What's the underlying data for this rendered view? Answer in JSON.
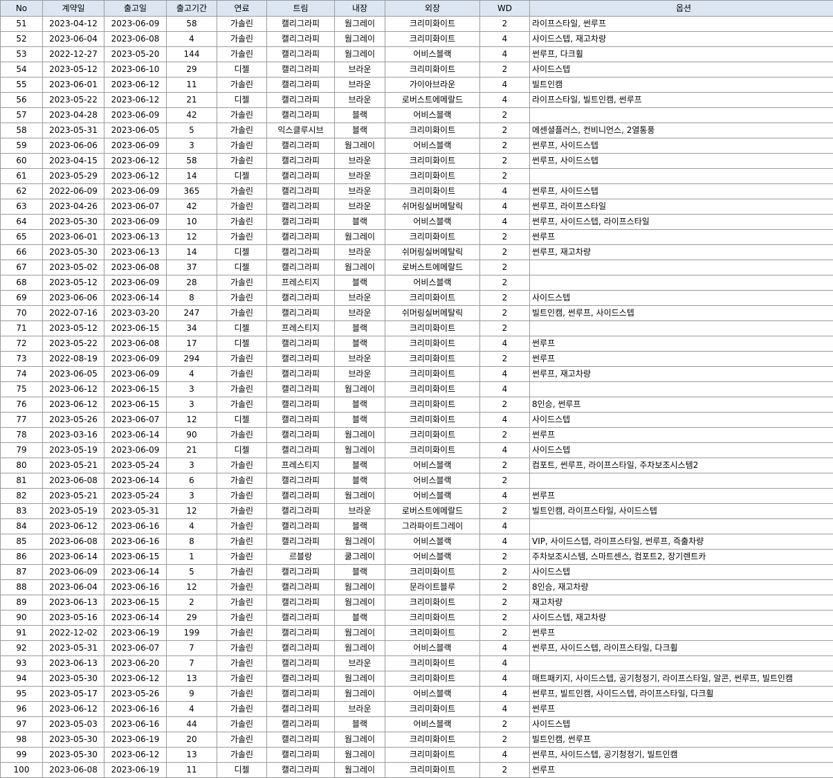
{
  "headers": [
    "No",
    "계약일",
    "출고일",
    "출고기간",
    "연료",
    "트림",
    "내장",
    "외장",
    "WD",
    "옵션"
  ],
  "rows": [
    [
      "51",
      "2023-04-12",
      "2023-06-09",
      "58",
      "가솔린",
      "캘리그라피",
      "웜그레이",
      "크리미화이트",
      "2",
      "라이프스타일, 썬루프"
    ],
    [
      "52",
      "2023-06-04",
      "2023-06-08",
      "4",
      "가솔린",
      "캘리그라피",
      "웜그레이",
      "크리미화이트",
      "4",
      "사이드스텝, 재고차량"
    ],
    [
      "53",
      "2022-12-27",
      "2023-05-20",
      "144",
      "가솔린",
      "캘리그라피",
      "웜그레이",
      "어비스블랙",
      "4",
      "썬루프, 다크휠"
    ],
    [
      "54",
      "2023-05-12",
      "2023-06-10",
      "29",
      "디젤",
      "캘리그라피",
      "브라운",
      "크리미화이트",
      "2",
      "사이드스텝"
    ],
    [
      "55",
      "2023-06-01",
      "2023-06-12",
      "11",
      "가솔린",
      "캘리그라피",
      "브라운",
      "가이아브라운",
      "4",
      "빌트인캠"
    ],
    [
      "56",
      "2023-05-22",
      "2023-06-12",
      "21",
      "디젤",
      "캘리그라피",
      "브라운",
      "로버스트에메랄드",
      "4",
      "라이프스타일, 빌트인캠, 썬루프"
    ],
    [
      "57",
      "2023-04-28",
      "2023-06-09",
      "42",
      "가솔린",
      "캘리그라피",
      "블랙",
      "어비스블랙",
      "2",
      ""
    ],
    [
      "58",
      "2023-05-31",
      "2023-06-05",
      "5",
      "가솔린",
      "익스클루시브",
      "블랙",
      "크리미화이트",
      "2",
      "에센셜플러스, 컨비니언스, 2열통풍"
    ],
    [
      "59",
      "2023-06-06",
      "2023-06-09",
      "3",
      "가솔린",
      "캘리그라피",
      "웜그레이",
      "어비스블랙",
      "2",
      "썬루프, 사이드스텝"
    ],
    [
      "60",
      "2023-04-15",
      "2023-06-12",
      "58",
      "가솔린",
      "캘리그라피",
      "브라운",
      "크리미화이트",
      "2",
      "썬루프, 사이드스텝"
    ],
    [
      "61",
      "2023-05-29",
      "2023-06-12",
      "14",
      "디젤",
      "캘리그라피",
      "브라운",
      "크리미화이트",
      "2",
      ""
    ],
    [
      "62",
      "2022-06-09",
      "2023-06-09",
      "365",
      "가솔린",
      "캘리그라피",
      "브라운",
      "크리미화이트",
      "4",
      "썬루프, 사이드스텝"
    ],
    [
      "63",
      "2023-04-26",
      "2023-06-07",
      "42",
      "가솔린",
      "캘리그라피",
      "브라운",
      "쉬머링실버메탈릭",
      "4",
      "썬루프, 라이프스타일"
    ],
    [
      "64",
      "2023-05-30",
      "2023-06-09",
      "10",
      "가솔린",
      "캘리그라피",
      "블랙",
      "어비스블랙",
      "4",
      "썬루프, 사이드스텝, 라이프스타일"
    ],
    [
      "65",
      "2023-06-01",
      "2023-06-13",
      "12",
      "가솔린",
      "캘리그라피",
      "웜그레이",
      "크리미화이트",
      "2",
      "썬루프"
    ],
    [
      "66",
      "2023-05-30",
      "2023-06-13",
      "14",
      "디젤",
      "캘리그라피",
      "브라운",
      "쉬머링실버메탈릭",
      "2",
      "썬루프, 재고차량"
    ],
    [
      "67",
      "2023-05-02",
      "2023-06-08",
      "37",
      "디젤",
      "캘리그라피",
      "웜그레이",
      "로버스트에메랄드",
      "2",
      ""
    ],
    [
      "68",
      "2023-05-12",
      "2023-06-09",
      "28",
      "가솔린",
      "프레스티지",
      "블랙",
      "어비스블랙",
      "2",
      ""
    ],
    [
      "69",
      "2023-06-06",
      "2023-06-14",
      "8",
      "가솔린",
      "캘리그라피",
      "브라운",
      "크리미화이트",
      "2",
      "사이드스텝"
    ],
    [
      "70",
      "2022-07-16",
      "2023-03-20",
      "247",
      "가솔린",
      "캘리그라피",
      "브라운",
      "쉬머링실버메탈릭",
      "2",
      "빌트인캠, 썬루프, 사이드스텝"
    ],
    [
      "71",
      "2023-05-12",
      "2023-06-15",
      "34",
      "디젤",
      "프레스티지",
      "블랙",
      "크리미화이트",
      "2",
      ""
    ],
    [
      "72",
      "2023-05-22",
      "2023-06-08",
      "17",
      "디젤",
      "캘리그라피",
      "블랙",
      "크리미화이트",
      "4",
      "썬루프"
    ],
    [
      "73",
      "2022-08-19",
      "2023-06-09",
      "294",
      "가솔린",
      "캘리그라피",
      "브라운",
      "크리미화이트",
      "2",
      "썬루프"
    ],
    [
      "74",
      "2023-06-05",
      "2023-06-09",
      "4",
      "가솔린",
      "캘리그라피",
      "브라운",
      "크리미화이트",
      "4",
      "썬루프, 재고차량"
    ],
    [
      "75",
      "2023-06-12",
      "2023-06-15",
      "3",
      "가솔린",
      "캘리그라피",
      "웜그레이",
      "크리미화이트",
      "4",
      ""
    ],
    [
      "76",
      "2023-06-12",
      "2023-06-15",
      "3",
      "가솔린",
      "캘리그라피",
      "블랙",
      "크리미화이트",
      "2",
      "8인승, 썬루프"
    ],
    [
      "77",
      "2023-05-26",
      "2023-06-07",
      "12",
      "디젤",
      "캘리그라피",
      "블랙",
      "크리미화이트",
      "4",
      "사이드스텝"
    ],
    [
      "78",
      "2023-03-16",
      "2023-06-14",
      "90",
      "가솔린",
      "캘리그라피",
      "웜그레이",
      "크리미화이트",
      "2",
      "썬루프"
    ],
    [
      "79",
      "2023-05-19",
      "2023-06-09",
      "21",
      "디젤",
      "캘리그라피",
      "웜그레이",
      "크리미화이트",
      "4",
      "사이드스텝"
    ],
    [
      "80",
      "2023-05-21",
      "2023-05-24",
      "3",
      "가솔린",
      "프레스티지",
      "블랙",
      "어비스블랙",
      "2",
      "컴포트, 썬루프, 라이프스타일, 주차보조시스템2"
    ],
    [
      "81",
      "2023-06-08",
      "2023-06-14",
      "6",
      "가솔린",
      "캘리그라피",
      "블랙",
      "어비스블랙",
      "2",
      ""
    ],
    [
      "82",
      "2023-05-21",
      "2023-05-24",
      "3",
      "가솔린",
      "캘리그라피",
      "웜그레이",
      "어비스블랙",
      "4",
      "썬루프"
    ],
    [
      "83",
      "2023-05-19",
      "2023-05-31",
      "12",
      "가솔린",
      "캘리그라피",
      "브라운",
      "로버스트에메랄드",
      "2",
      "빌트인캠, 라이프스타일, 사이드스텝"
    ],
    [
      "84",
      "2023-06-12",
      "2023-06-16",
      "4",
      "가솔린",
      "캘리그라피",
      "블랙",
      "그라파이트그레이",
      "4",
      ""
    ],
    [
      "85",
      "2023-06-08",
      "2023-06-16",
      "8",
      "가솔린",
      "캘리그라피",
      "웜그레이",
      "어비스블랙",
      "4",
      "VIP, 사이드스텝, 라이프스타일, 썬루프, 즉출차량"
    ],
    [
      "86",
      "2023-06-14",
      "2023-06-15",
      "1",
      "가솔린",
      "르블랑",
      "쿨그레이",
      "어비스블랙",
      "2",
      "주차보조시스템, 스마트센스, 컴포트2, 장기렌트카"
    ],
    [
      "87",
      "2023-06-09",
      "2023-06-14",
      "5",
      "가솔린",
      "캘리그라피",
      "블랙",
      "크리미화이트",
      "2",
      "사이드스텝"
    ],
    [
      "88",
      "2023-06-04",
      "2023-06-16",
      "12",
      "가솔린",
      "캘리그라피",
      "웜그레이",
      "문라이트블루",
      "2",
      "8인승, 재고차량"
    ],
    [
      "89",
      "2023-06-13",
      "2023-06-15",
      "2",
      "가솔린",
      "캘리그라피",
      "웜그레이",
      "크리미화이트",
      "2",
      "재고차량"
    ],
    [
      "90",
      "2023-05-16",
      "2023-06-14",
      "29",
      "가솔린",
      "캘리그라피",
      "블랙",
      "크리미화이트",
      "2",
      "사이드스텝, 재고차량"
    ],
    [
      "91",
      "2022-12-02",
      "2023-06-19",
      "199",
      "가솔린",
      "캘리그라피",
      "웜그레이",
      "크리미화이트",
      "2",
      "썬루프"
    ],
    [
      "92",
      "2023-05-31",
      "2023-06-07",
      "7",
      "가솔린",
      "캘리그라피",
      "웜그레이",
      "어비스블랙",
      "4",
      "썬루프, 사이드스텝, 라이프스타일, 다크휠"
    ],
    [
      "93",
      "2023-06-13",
      "2023-06-20",
      "7",
      "가솔린",
      "캘리그라피",
      "브라운",
      "크리미화이트",
      "4",
      ""
    ],
    [
      "94",
      "2023-05-30",
      "2023-06-12",
      "13",
      "가솔린",
      "캘리그라피",
      "웜그레이",
      "크리미화이트",
      "4",
      "매트패키지, 사이드스텝, 공기청정기, 라이프스타일, 알콘, 썬루프, 빌트인캠"
    ],
    [
      "95",
      "2023-05-17",
      "2023-05-26",
      "9",
      "가솔린",
      "캘리그라피",
      "웜그레이",
      "어비스블랙",
      "4",
      "썬루프, 빌트인캠, 사이드스텝, 라이프스타일, 다크휠"
    ],
    [
      "96",
      "2023-06-12",
      "2023-06-16",
      "4",
      "가솔린",
      "캘리그라피",
      "브라운",
      "크리미화이트",
      "4",
      "썬루프"
    ],
    [
      "97",
      "2023-05-03",
      "2023-06-16",
      "44",
      "가솔린",
      "캘리그라피",
      "블랙",
      "어비스블랙",
      "2",
      "사이드스텝"
    ],
    [
      "98",
      "2023-05-30",
      "2023-06-19",
      "20",
      "가솔린",
      "캘리그라피",
      "웜그레이",
      "크리미화이트",
      "2",
      "빌트인캠, 썬루프"
    ],
    [
      "99",
      "2023-05-30",
      "2023-06-12",
      "13",
      "가솔린",
      "캘리그라피",
      "웜그레이",
      "크리미화이트",
      "4",
      "썬루프, 사이드스텝, 공기청정기, 빌트인캠"
    ],
    [
      "100",
      "2023-06-08",
      "2023-06-19",
      "11",
      "디젤",
      "캘리그라피",
      "웜그레이",
      "크리미화이트",
      "2",
      "썬루프"
    ]
  ]
}
